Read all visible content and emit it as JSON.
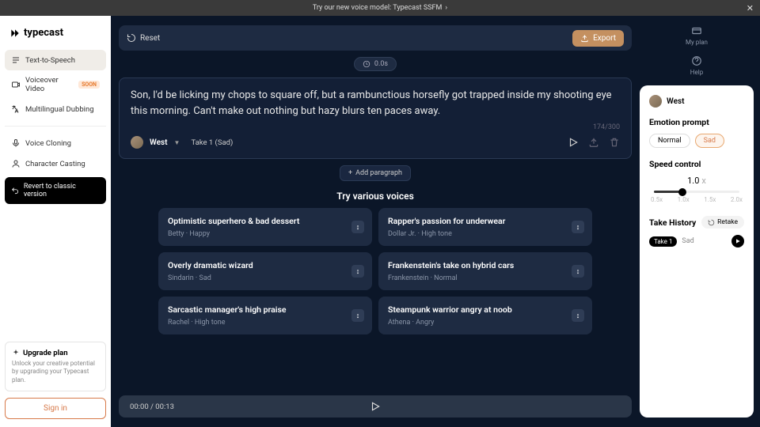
{
  "banner": {
    "text": "Try our new voice model: Typecast SSFM",
    "close": "✕"
  },
  "logo": {
    "text": "typecast"
  },
  "nav": {
    "tts": "Text-to-Speech",
    "voiceover": "Voiceover Video",
    "soon": "SOON",
    "dubbing": "Multilingual Dubbing",
    "cloning": "Voice Cloning",
    "casting": "Character Casting",
    "revert": "Revert to classic version"
  },
  "upgrade": {
    "title": "Upgrade plan",
    "text": "Unlock your creative potential by upgrading your Typecast plan."
  },
  "signin": "Sign in",
  "toolbar": {
    "reset": "Reset",
    "export": "Export"
  },
  "duration": "0.0s",
  "block": {
    "text": "Son, I'd be licking my chops to square off, but a rambunctious horsefly got trapped inside my shooting eye this morning. Can't make out nothing but hazy blurs ten paces away.",
    "count": "174/300",
    "voice": "West",
    "take": "Take 1 (Sad)"
  },
  "addPara": "Add paragraph",
  "voicesTitle": "Try various voices",
  "voices": [
    {
      "title": "Optimistic superhero & bad dessert",
      "sub": "Betty · Happy"
    },
    {
      "title": "Rapper's passion for underwear",
      "sub": "Dollar Jr. · High tone"
    },
    {
      "title": "Overly dramatic wizard",
      "sub": "Sindarin · Sad"
    },
    {
      "title": "Frankenstein's take on hybrid cars",
      "sub": "Frankenstein · Normal"
    },
    {
      "title": "Sarcastic manager's high praise",
      "sub": "Rachel · High tone"
    },
    {
      "title": "Steampunk warrior angry at noob",
      "sub": "Athena · Angry"
    }
  ],
  "player": {
    "time": "00:00 / 00:13"
  },
  "rtop": {
    "plan": "My plan",
    "help": "Help"
  },
  "panel": {
    "voice": "West",
    "emotionTitle": "Emotion prompt",
    "emotions": {
      "normal": "Normal",
      "sad": "Sad"
    },
    "speedTitle": "Speed control",
    "speedVal": "1.0",
    "speedLabels": [
      "0.5x",
      "1.0x",
      "1.5x",
      "2.0x"
    ],
    "historyTitle": "Take History",
    "retake": "Retake",
    "take": {
      "badge": "Take 1",
      "emotion": "Sad"
    }
  }
}
